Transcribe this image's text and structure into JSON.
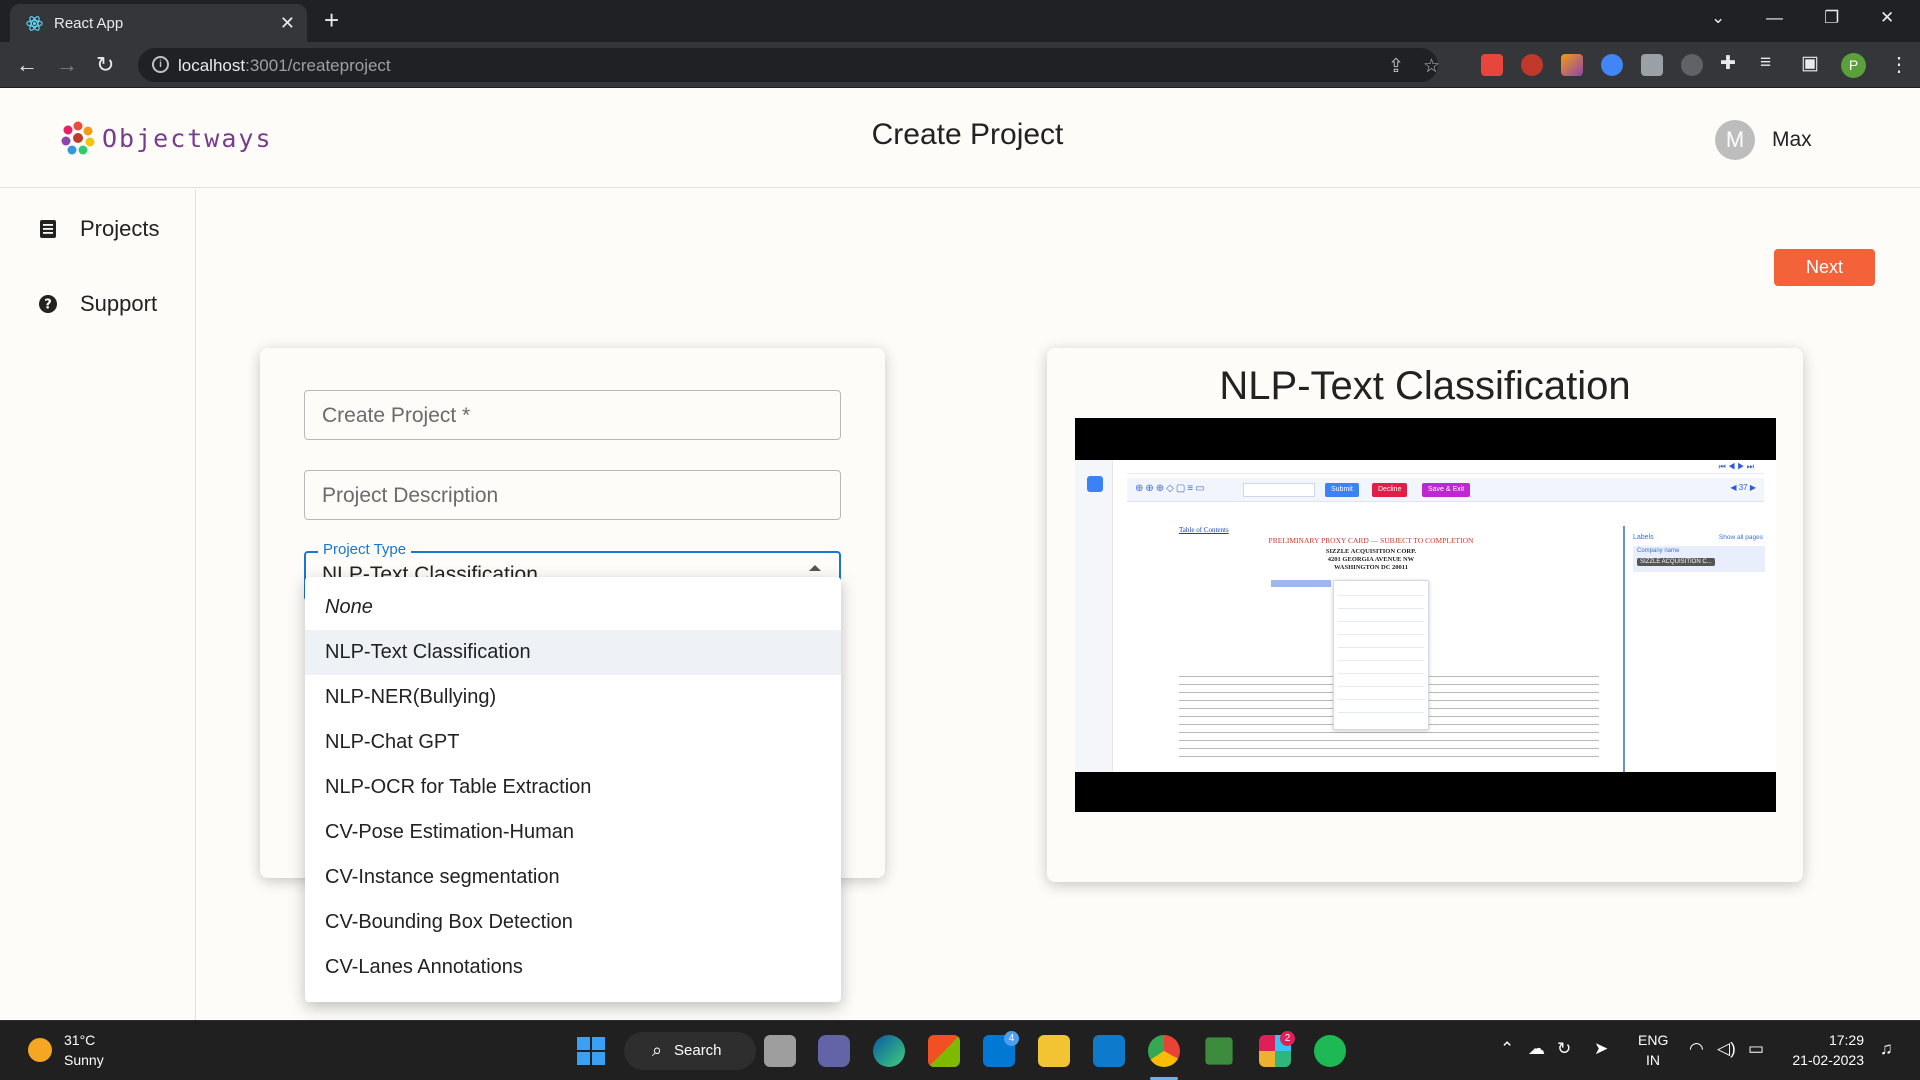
{
  "browser": {
    "tab_title": "React App",
    "tab_close": "✕",
    "new_tab": "+",
    "url_host": "localhost",
    "url_path": ":3001/createproject"
  },
  "header": {
    "logo_text": "Objectways",
    "page_title": "Create Project",
    "user_initial": "M",
    "user_name": "Max"
  },
  "sidebar": {
    "items": [
      {
        "label": "Projects",
        "icon": "list-icon"
      },
      {
        "label": "Support",
        "icon": "help-icon"
      }
    ]
  },
  "toolbar": {
    "next_label": "Next"
  },
  "form": {
    "project_name_placeholder": "Create Project *",
    "project_description_placeholder": "Project Description",
    "project_type_label": "Project Type",
    "project_type_value": "NLP-Text Classification"
  },
  "dropdown": {
    "options": [
      "None",
      "NLP-Text Classification",
      "NLP-NER(Bullying)",
      "NLP-Chat GPT",
      "NLP-OCR for Table Extraction",
      "CV-Pose Estimation-Human",
      "CV-Instance segmentation",
      "CV-Bounding Box Detection",
      "CV-Lanes Annotations"
    ],
    "selected_index": 1
  },
  "preview": {
    "title": "NLP-Text Classification",
    "doc_heading": "PRELIMINARY PROXY CARD — SUBJECT TO COMPLETION",
    "doc_company": "SIZZLE ACQUISITION CORP.",
    "doc_address_1": "4201 GEORGIA AVENUE NW",
    "doc_address_2": "WASHINGTON DC 20011",
    "doc_toc": "Table of Contents",
    "submit_btn": "Submit",
    "decline_btn": "Decline",
    "save_exit_btn": "Save & Exit",
    "labels_heading": "Labels",
    "show_all": "Show all pages",
    "company_label": "Company name",
    "company_chip": "SIZZLE ACQUISITION C..."
  },
  "taskbar": {
    "temperature": "31°C",
    "weather": "Sunny",
    "search_label": "Search",
    "language_1": "ENG",
    "language_2": "IN",
    "time": "17:29",
    "date": "21-02-2023",
    "teams_badge": "4",
    "slack_badge": "2"
  },
  "colors": {
    "accent": "#f4623a",
    "focus": "#1976d2",
    "page_bg": "#fdfcf8"
  }
}
